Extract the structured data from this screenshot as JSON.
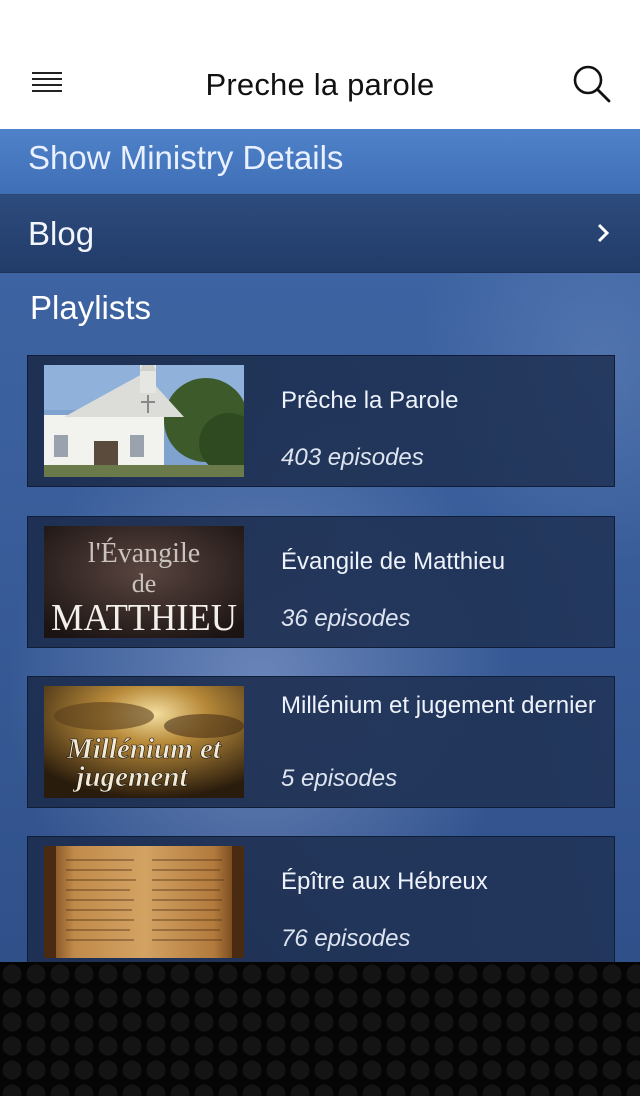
{
  "header": {
    "title": "Preche la parole",
    "menu_icon": "hamburger-menu-icon",
    "search_icon": "search-icon"
  },
  "ministry": {
    "label": "Show Ministry Details"
  },
  "blog": {
    "label": "Blog"
  },
  "playlists": {
    "title": "Playlists",
    "items": [
      {
        "name": "Prêche la Parole",
        "count": "403 episodes",
        "thumb": "church-photo"
      },
      {
        "name": "Évangile de Matthieu",
        "count": "36 episodes",
        "thumb": "matthieu-title-art",
        "thumb_text": {
          "line1": "l'Évangile",
          "line2": "de",
          "line3": "MATTHIEU"
        }
      },
      {
        "name": "Millénium et jugement dernier",
        "count": "5 episodes",
        "thumb": "millenium-sky-art",
        "thumb_text": {
          "line1": "Millénium et",
          "line2": "jugement"
        }
      },
      {
        "name": "Épître aux Hébreux",
        "count": "76 episodes",
        "thumb": "scroll-photo"
      }
    ]
  }
}
